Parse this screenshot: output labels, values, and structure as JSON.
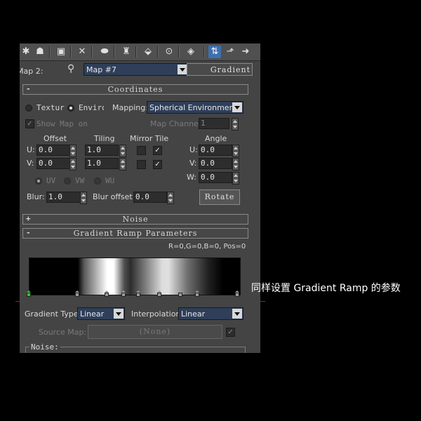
{
  "toolbar": {
    "icons": [
      "sample-sphere-icon",
      "get-material-icon",
      "put-material-icon",
      "delete-icon",
      "make-unique-icon",
      "put-to-library-icon",
      "material-effects-channel-icon",
      "show-map-in-viewport-icon",
      "show-end-result-icon",
      "go-to-parent-icon",
      "go-forward-icon"
    ]
  },
  "map_row": {
    "label": "Map 2:",
    "map_name": "Map #7",
    "map_type": "Gradient Ramp"
  },
  "coordinates": {
    "title": "Coordinates",
    "texture_label": "Texture",
    "environ_label": "Environ",
    "mapping_label": "Mapping:",
    "mapping_value": "Spherical Environment",
    "show_map_label": "Show Map on",
    "map_channel_label": "Map Channel:",
    "map_channel_value": "1",
    "offset_label": "Offset",
    "tiling_label": "Tiling",
    "mirror_tile_label": "Mirror Tile",
    "angle_label": "Angle",
    "u_label": "U:",
    "v_label": "V:",
    "w_label": "W:",
    "u_offset": "0.0",
    "v_offset": "0.0",
    "u_tiling": "1.0",
    "v_tiling": "1.0",
    "u_angle": "0.0",
    "v_angle": "0.0",
    "w_angle": "0.0",
    "uv_label": "UV",
    "vw_label": "VW",
    "wu_label": "WU",
    "blur_label": "Blur:",
    "blur_value": "1.0",
    "blur_offset_label": "Blur offset:",
    "blur_offset_value": "0.0",
    "rotate_label": "Rotate"
  },
  "noise_rollout": {
    "title": "Noise"
  },
  "gradient": {
    "title": "Gradient Ramp Parameters",
    "readout": "R=0,G=0,B=0, Pos=0",
    "flags": [
      0.0,
      0.23,
      0.37,
      0.45,
      0.52,
      0.62,
      0.72,
      0.8,
      0.99
    ],
    "gradient_type_label": "Gradient Type:",
    "gradient_type_value": "Linear",
    "interpolation_label": "Interpolation:",
    "interpolation_value": "Linear",
    "source_map_label": "Source Map:",
    "source_map_value": "(None)",
    "noise_label": "Noise:"
  },
  "annotation": "同样设置 Gradient Ramp 的参数",
  "colors": {
    "selected_flag": "#2ec82e",
    "annotation_line": "#b01818",
    "active_toolbar": "#3f6fb0"
  }
}
